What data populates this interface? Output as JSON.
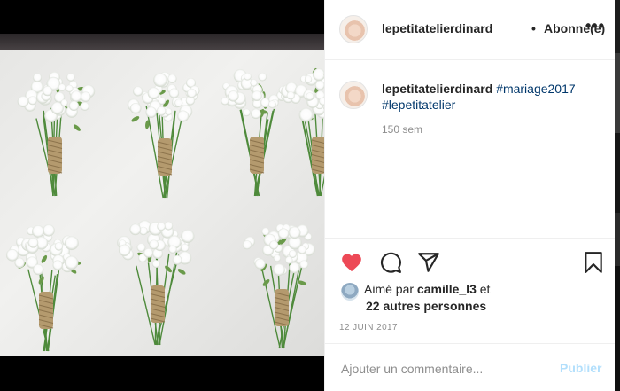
{
  "post": {
    "username": "lepetitatelierdinard",
    "separator": "•",
    "follow_state": "Abonné(e)",
    "more_icon": "more-dots-icon",
    "more_glyph": "•••"
  },
  "caption": {
    "username": "lepetitatelierdinard",
    "hashtag_1": "#mariage2017",
    "hashtag_2": "#lepetitatelier",
    "time_ago": "150 sem"
  },
  "actions": {
    "like_icon": "heart-filled-icon",
    "comment_icon": "comment-icon",
    "share_icon": "share-paper-plane-icon",
    "save_icon": "bookmark-icon",
    "like_color": "#ed4956"
  },
  "likes": {
    "prefix": "Aimé par",
    "liker": "camille_l3",
    "suffix": "et",
    "others": "22 autres personnes"
  },
  "date": "12 JUIN 2017",
  "comment": {
    "placeholder": "Ajouter un commentaire...",
    "post_label": "Publier",
    "post_color": "#b2dffc"
  },
  "photo": {
    "subject": "boutonnieres-of-babys-breath-with-twine",
    "colors": {
      "board": "#eaeae8",
      "flower": "#ffffff",
      "stem": "#4e8a3b",
      "twine": "#b49a6e"
    }
  }
}
